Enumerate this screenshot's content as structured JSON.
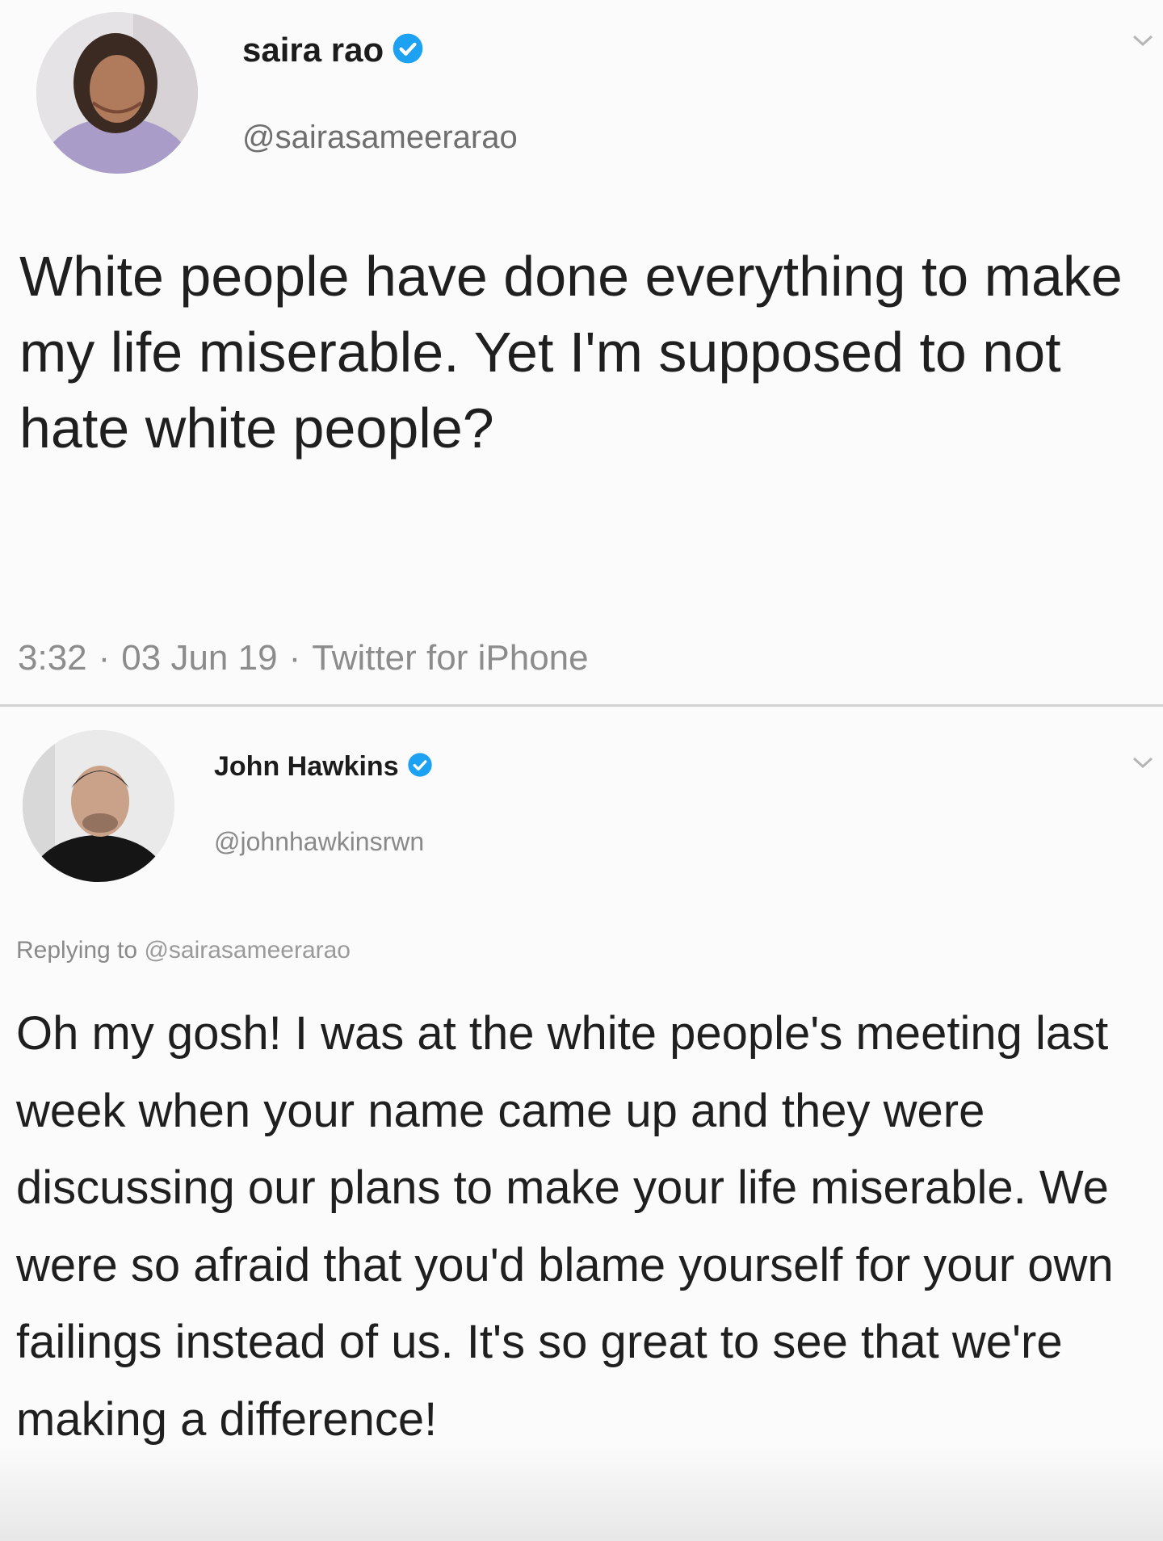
{
  "tweets": [
    {
      "display_name": "saira rao",
      "handle": "@sairasameerarao",
      "verified": true,
      "text": "White people have done everything to make my life miserable. Yet I'm supposed to not hate white people?",
      "time": "3:32",
      "date": "03 Jun 19",
      "source": "Twitter for iPhone"
    },
    {
      "display_name": "John Hawkins",
      "handle": "@johnhawkinsrwn",
      "verified": true,
      "replying_label": "Replying to",
      "replying_to": "@sairasameerarao",
      "text": "Oh my gosh! I was at the white people's meeting last week when your name came up and they were discussing our plans to make your life miserable. We were so afraid that you'd blame yourself for your own failings instead of us. It's so great to see that we're making a difference!"
    }
  ],
  "meta_separator": "·",
  "colors": {
    "verified_blue": "#1da1f2",
    "secondary_text": "#8c8c8c",
    "primary_text": "#1f1f1f",
    "divider": "#d2d2d2"
  },
  "icons": {
    "verified": "verified-badge-icon",
    "caret": "chevron-down-icon"
  }
}
